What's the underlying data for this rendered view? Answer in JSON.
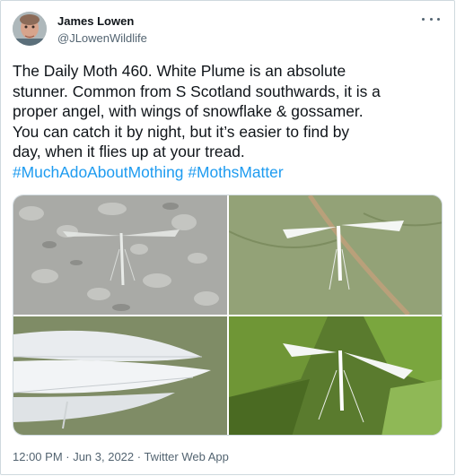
{
  "author": {
    "name": "James Lowen",
    "handle": "@JLowenWildlife"
  },
  "tweet": {
    "lines": [
      "The Daily Moth 460. White Plume is an absolute",
      "stunner. Common from S Scotland southwards, it is a",
      "proper angel, with wings of snowflake & gossamer.",
      "You can catch it by night, but it’s easier to find by",
      "day, when it flies up at your tread."
    ],
    "hashtags": [
      "#MuchAdoAboutMothing",
      "#MothsMatter"
    ]
  },
  "media": {
    "photos": [
      "white-plume-moth-on-grey-stone-photo",
      "white-plume-moth-on-leaf-photo",
      "white-plume-wing-closeup-photo",
      "white-plume-moth-among-nettles-photo"
    ]
  },
  "meta": {
    "timestamp": "12:00 PM · Jun 3, 2022 · Twitter Web App"
  },
  "colors": {
    "link": "#1d9bf0",
    "secondary_text": "#536471",
    "border": "#cfd9de"
  }
}
